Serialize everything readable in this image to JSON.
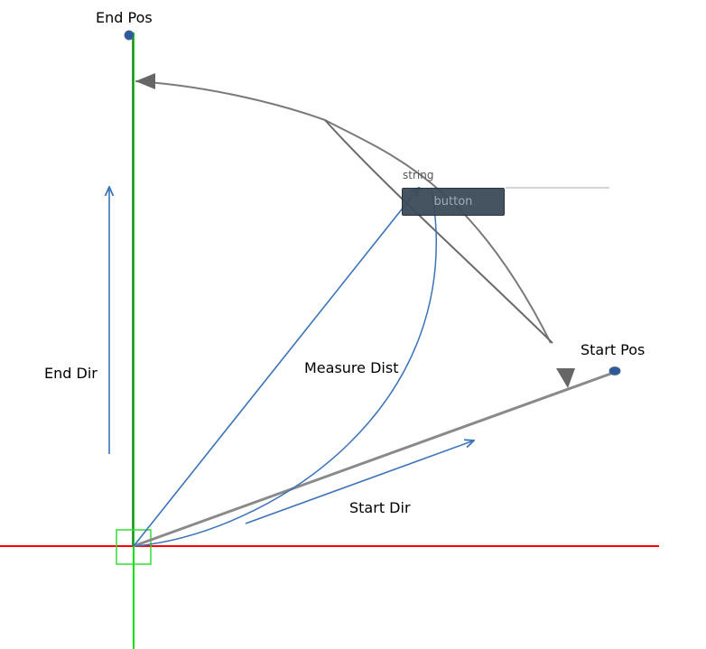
{
  "labels": {
    "end_pos": "End Pos",
    "start_pos": "Start Pos",
    "end_dir": "End Dir",
    "start_dir": "Start Dir",
    "measure_dist": "Measure Dist",
    "string_label": "string",
    "button_label": "button"
  },
  "colors": {
    "x_axis": "#ff0000",
    "y_axis": "#00e000",
    "y_axis_dark": "#2e6b2e",
    "arrows": "#3b73b9",
    "curve": "#7a7a7a",
    "handle": "#2c5aa0",
    "origin_box": "#33dd33"
  }
}
